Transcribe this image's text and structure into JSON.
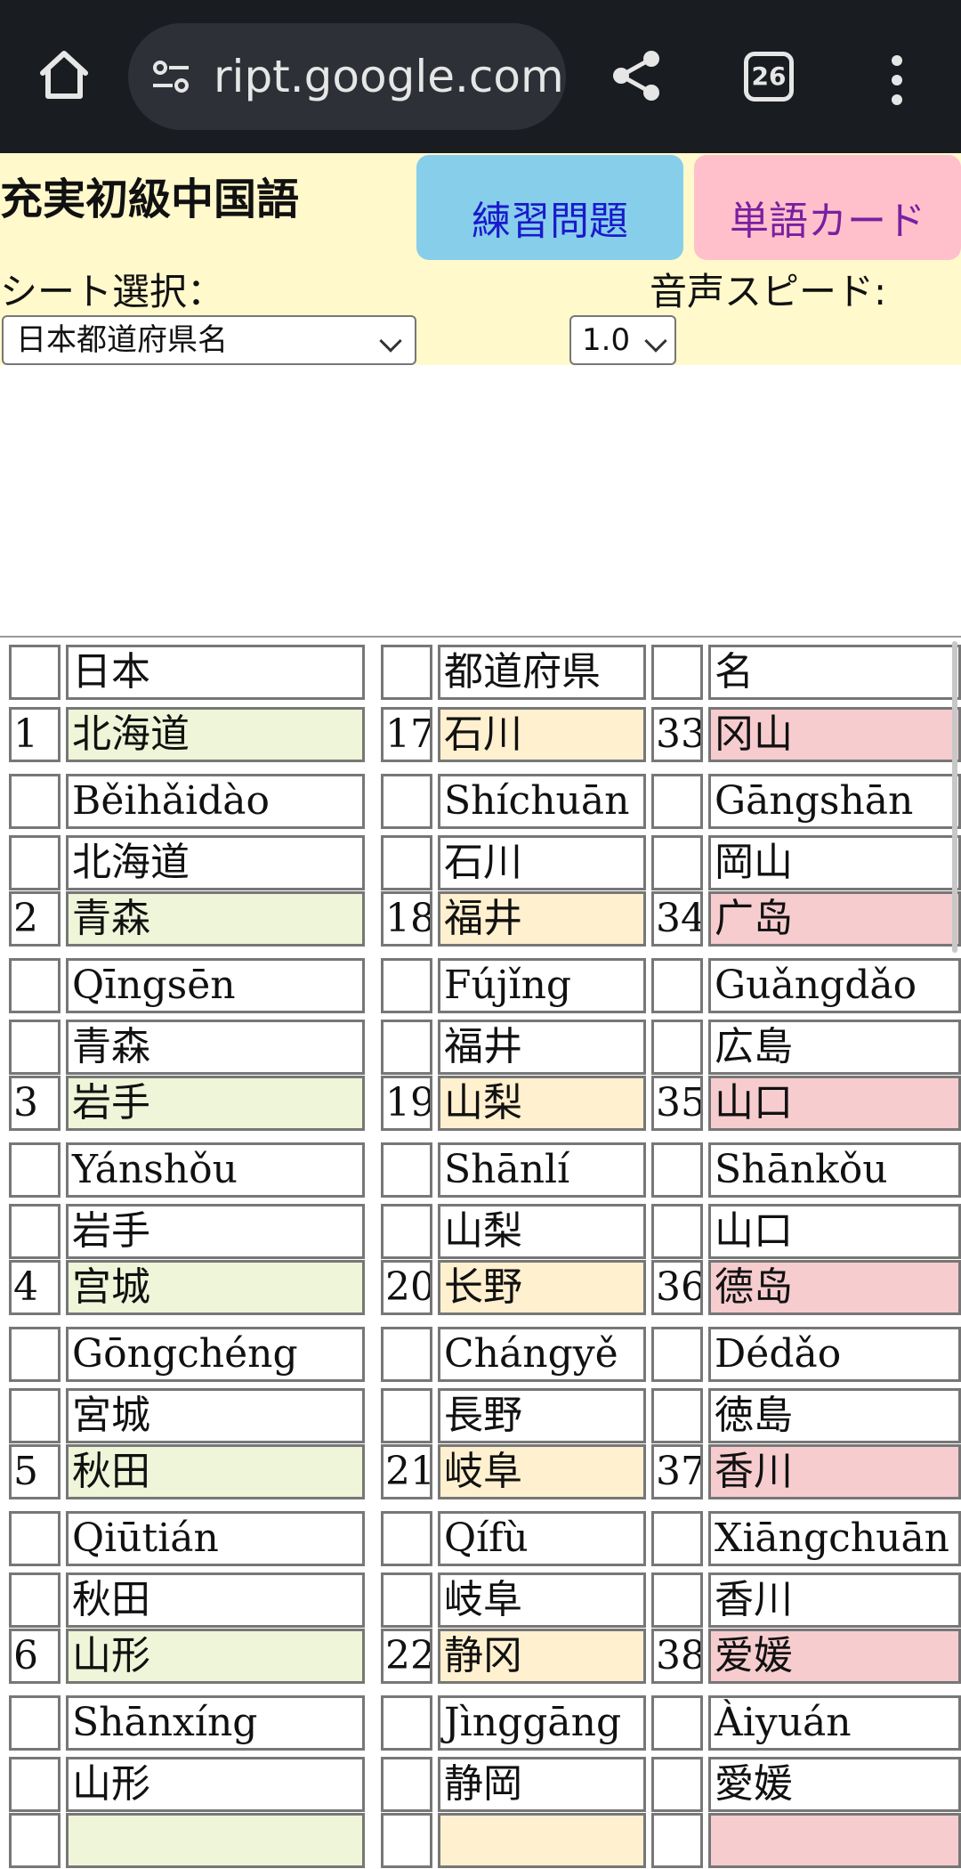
{
  "browser": {
    "url": "ript.google.com",
    "tab_count": "26"
  },
  "header": {
    "title": "充実初級中国語",
    "practice_button": "練習問題",
    "cards_button": "単語カード",
    "sheet_label": "シート選択：",
    "speed_label": "音声スピード:",
    "sheet_value": "日本都道府県名",
    "speed_value": "1.0"
  },
  "table": {
    "headers": [
      "日本",
      "都道府県",
      "名"
    ],
    "rows": [
      [
        {
          "n": "1",
          "kanji": "北海道",
          "pinyin": "Běihǎidào",
          "jp": "北海道"
        },
        {
          "n": "17",
          "kanji": "石川",
          "pinyin": "Shíchuān",
          "jp": "石川"
        },
        {
          "n": "33",
          "kanji": "冈山",
          "pinyin": "Gāngshān",
          "jp": "岡山"
        }
      ],
      [
        {
          "n": "2",
          "kanji": "青森",
          "pinyin": "Qīngsēn",
          "jp": "青森"
        },
        {
          "n": "18",
          "kanji": "福井",
          "pinyin": "Fújǐng",
          "jp": "福井"
        },
        {
          "n": "34",
          "kanji": "广岛",
          "pinyin": "Guǎngdǎo",
          "jp": "広島"
        }
      ],
      [
        {
          "n": "3",
          "kanji": "岩手",
          "pinyin": "Yánshǒu",
          "jp": "岩手"
        },
        {
          "n": "19",
          "kanji": "山梨",
          "pinyin": "Shānlí",
          "jp": "山梨"
        },
        {
          "n": "35",
          "kanji": "山口",
          "pinyin": "Shānkǒu",
          "jp": "山口"
        }
      ],
      [
        {
          "n": "4",
          "kanji": "宫城",
          "pinyin": "Gōngchéng",
          "jp": "宮城"
        },
        {
          "n": "20",
          "kanji": "长野",
          "pinyin": "Chángyě",
          "jp": "長野"
        },
        {
          "n": "36",
          "kanji": "德岛",
          "pinyin": "Dédǎo",
          "jp": "徳島"
        }
      ],
      [
        {
          "n": "5",
          "kanji": "秋田",
          "pinyin": "Qiūtián",
          "jp": "秋田"
        },
        {
          "n": "21",
          "kanji": "岐阜",
          "pinyin": "Qífù",
          "jp": "岐阜"
        },
        {
          "n": "37",
          "kanji": "香川",
          "pinyin": "Xiāngchuān",
          "jp": "香川"
        }
      ],
      [
        {
          "n": "6",
          "kanji": "山形",
          "pinyin": "Shānxíng",
          "jp": "山形"
        },
        {
          "n": "22",
          "kanji": "静冈",
          "pinyin": "Jìnggāng",
          "jp": "静岡"
        },
        {
          "n": "38",
          "kanji": "爱媛",
          "pinyin": "Àiyuán",
          "jp": "愛媛"
        }
      ]
    ]
  },
  "colors": {
    "header_bg": "#fff9cc",
    "practice_bg": "#87ceeb",
    "cards_bg": "#ffc0cb",
    "col1_highlight": "#eef5d8",
    "col2_highlight": "#fff0cf",
    "col3_highlight": "#f6cccf"
  }
}
